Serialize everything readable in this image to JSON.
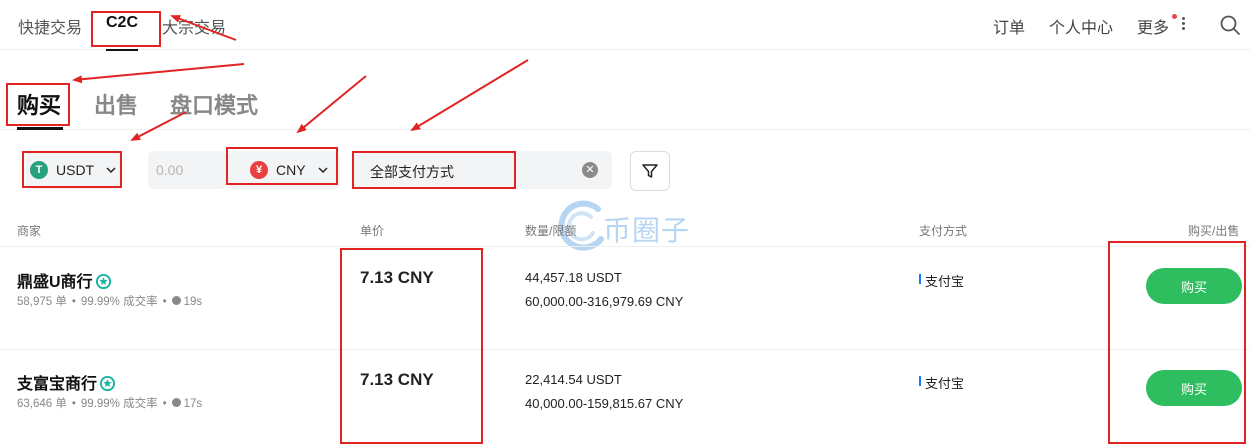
{
  "top_nav": {
    "tabs": [
      {
        "label": "快捷交易"
      },
      {
        "label": "C2C"
      },
      {
        "label": "大宗交易"
      }
    ],
    "right": {
      "orders": "订单",
      "profile": "个人中心",
      "more": "更多"
    }
  },
  "sub_tabs": [
    {
      "label": "购买"
    },
    {
      "label": "出售"
    },
    {
      "label": "盘口模式"
    }
  ],
  "filters": {
    "coin": {
      "badge": "T",
      "value": "USDT"
    },
    "amount_placeholder": "0.00",
    "fiat": {
      "badge": "¥",
      "value": "CNY"
    },
    "payment_method": "全部支付方式"
  },
  "columns": {
    "merchant": "商家",
    "unit_price": "单价",
    "quantity_limit": "数量/限额",
    "payment": "支付方式",
    "action": "购买/出售"
  },
  "listings": [
    {
      "merchant": "鼎盛U商行",
      "orders": "58,975 单",
      "completion": "99.99% 成交率",
      "time": "19s",
      "price": "7.13 CNY",
      "quantity": "44,457.18 USDT",
      "limit": "60,000.00-316,979.69 CNY",
      "payment": "支付宝",
      "action": "购买"
    },
    {
      "merchant": "支富宝商行",
      "orders": "63,646 单",
      "completion": "99.99% 成交率",
      "time": "17s",
      "price": "7.13 CNY",
      "quantity": "22,414.54 USDT",
      "limit": "40,000.00-159,815.67 CNY",
      "payment": "支付宝",
      "action": "购买"
    }
  ],
  "watermark": "币圈子",
  "colors": {
    "buy_green": "#2fbe5f",
    "usdt_green": "#26a17b",
    "cny_red": "#e84142",
    "annotation_red": "#e02424",
    "verified_teal": "#17b3a3",
    "notify_dot": "#e5484d"
  }
}
